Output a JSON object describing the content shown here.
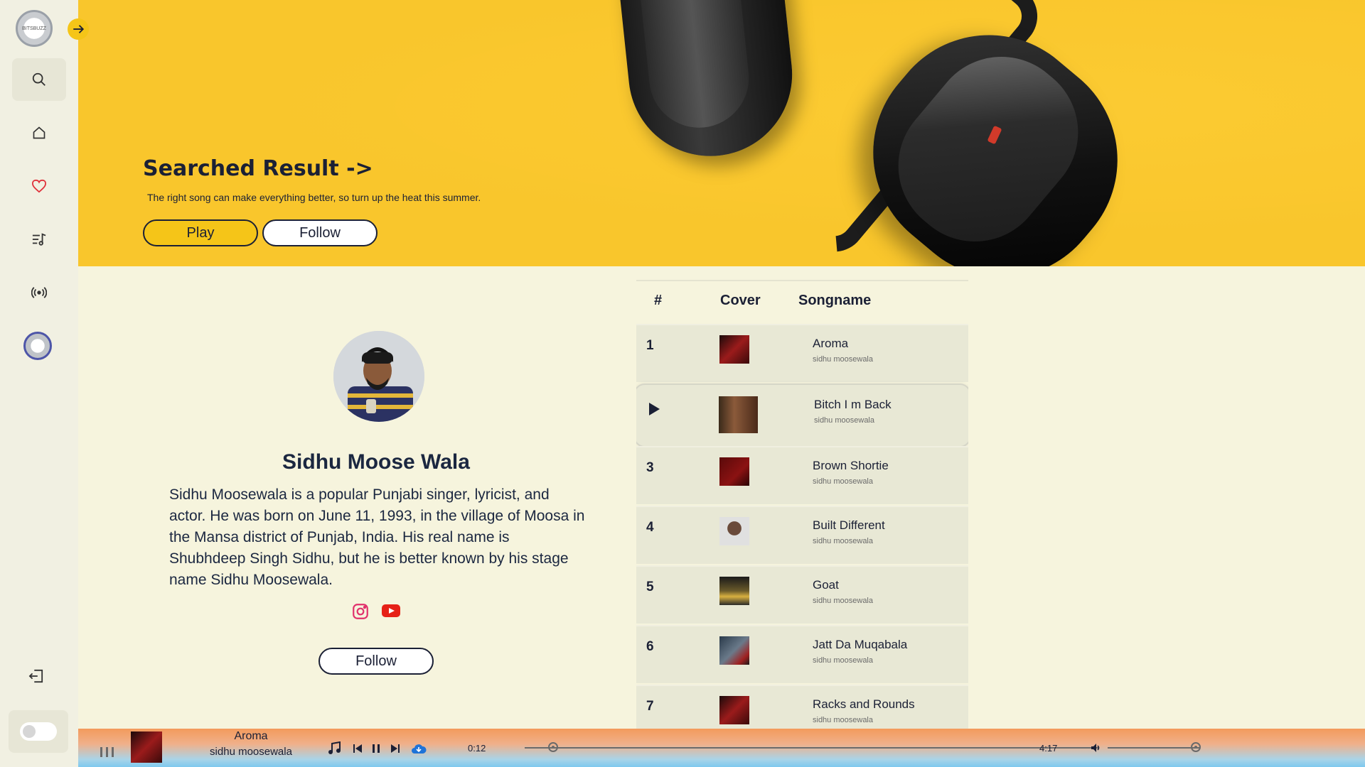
{
  "app": {
    "logo_text": "BITSBUZZ"
  },
  "hero": {
    "title": "Searched Result ->",
    "subtitle": "The right song can make everything better, so turn up the heat this summer.",
    "play_label": "Play",
    "follow_label": "Follow"
  },
  "artist": {
    "name": "Sidhu Moose Wala",
    "bio": "Sidhu Moosewala is a popular Punjabi singer, lyricist, and actor. He was born on June 11, 1993, in the village of Moosa in the Mansa district of Punjab, India. His real name is Shubhdeep Singh Sidhu, but he is better known by his stage name Sidhu Moosewala.",
    "follow_label": "Follow",
    "social": [
      "instagram-icon",
      "youtube-icon"
    ]
  },
  "table": {
    "headers": {
      "num": "#",
      "cover": "Cover",
      "name": "Songname"
    },
    "songs": [
      {
        "num": "1",
        "title": "Aroma",
        "artist": "sidhu moosewala",
        "cover_color": "#9b1b1b"
      },
      {
        "num": "",
        "title": "Bitch I m Back",
        "artist": "sidhu moosewala",
        "cover_color": "#6b3a2a"
      },
      {
        "num": "3",
        "title": "Brown Shortie",
        "artist": "sidhu moosewala",
        "cover_color": "#8b1212"
      },
      {
        "num": "4",
        "title": "Built Different",
        "artist": "sidhu moosewala",
        "cover_color": "#cfcfcf"
      },
      {
        "num": "5",
        "title": "Goat",
        "artist": "sidhu moosewala",
        "cover_color": "#3a3020"
      },
      {
        "num": "6",
        "title": "Jatt Da Muqabala",
        "artist": "sidhu moosewala",
        "cover_color": "#2a3a4a"
      },
      {
        "num": "7",
        "title": "Racks and Rounds",
        "artist": "sidhu moosewala",
        "cover_color": "#9b1b1b"
      }
    ]
  },
  "player": {
    "title": "Aroma",
    "artist": "sidhu moosewala",
    "current_time": "0:12",
    "duration": "4:17",
    "progress": 0.05,
    "volume": 0.95
  },
  "colors": {
    "accent": "#f5c518",
    "background": "#f6f4dd",
    "sidebar": "#f1f0e2"
  }
}
